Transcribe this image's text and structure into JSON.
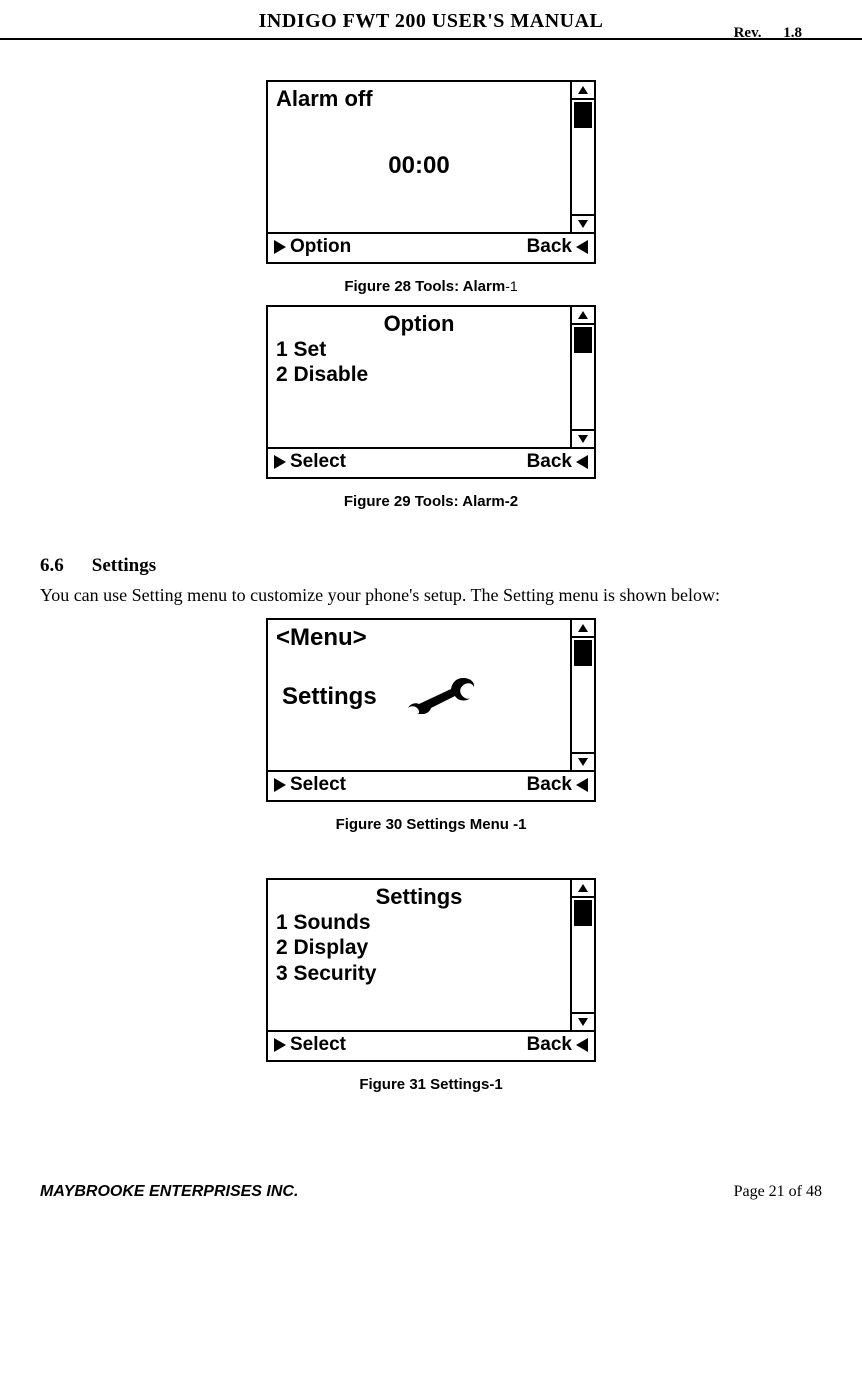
{
  "header": {
    "title": "INDIGO FWT 200 USER'S MANUAL",
    "rev_label": "Rev.",
    "rev_value": "1.8"
  },
  "figures": {
    "f28": {
      "title": "Alarm off",
      "time": "00:00",
      "sk_left": "Option",
      "sk_right": "Back",
      "caption_prefix": "Figure 28 Tools: Alarm",
      "caption_suffix": "-1"
    },
    "f29": {
      "title": "Option",
      "item1": "1 Set",
      "item2": "2 Disable",
      "sk_left": "Select",
      "sk_right": "Back",
      "caption": "Figure 29 Tools: Alarm-2"
    },
    "f30": {
      "menu_label": "<Menu>",
      "settings_label": "Settings",
      "sk_left": "Select",
      "sk_right": "Back",
      "caption": "Figure 30 Settings Menu -1"
    },
    "f31": {
      "title": "Settings",
      "item1": "1 Sounds",
      "item2": "2 Display",
      "item3": "3 Security",
      "sk_left": "Select",
      "sk_right": "Back",
      "caption": "Figure 31 Settings-1"
    }
  },
  "section": {
    "number": "6.6",
    "title": "Settings",
    "body": "You can use Setting menu to customize your phone's setup. The Setting menu is shown below:"
  },
  "footer": {
    "company": "MAYBROOKE ENTERPRISES INC.",
    "page": "Page 21 of 48"
  }
}
